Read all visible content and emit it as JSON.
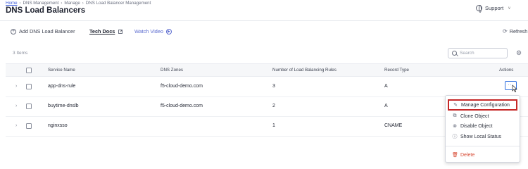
{
  "breadcrumb": {
    "home": "Home",
    "dns_management": "DNS Management",
    "manage": "Manage",
    "current": "DNS Load Balancer Management"
  },
  "page_title": "DNS Load Balancers",
  "header": {
    "support_label": "Support"
  },
  "toolbar": {
    "add_label": "Add DNS Load Balancer",
    "tech_docs_label": "Tech Docs",
    "watch_video_label": "Watch Video",
    "refresh_label": "Refresh"
  },
  "table": {
    "items_count": "3 Items",
    "search_placeholder": "Search",
    "columns": {
      "service_name": "Service Name",
      "dns_zones": "DNS Zones",
      "rules_count": "Number of Load Balancing Rules",
      "record_type": "Record Type",
      "actions": "Actions"
    },
    "rows": [
      {
        "service_name": "app-dns-rule",
        "dns_zones": "f5-cloud-demo.com",
        "rules_count": "3",
        "record_type": "A"
      },
      {
        "service_name": "buytime-dnslb",
        "dns_zones": "f5-cloud-demo.com",
        "rules_count": "2",
        "record_type": "A"
      },
      {
        "service_name": "nginxsso",
        "dns_zones": "",
        "rules_count": "1",
        "record_type": "CNAME"
      }
    ],
    "actions_button": "···"
  },
  "actions_menu": {
    "manage_configuration": "Manage Configuration",
    "clone_object": "Clone Object",
    "disable_object": "Disable Object",
    "show_local_status": "Show Local Status",
    "delete": "Delete"
  },
  "colors": {
    "accent": "#2f6fe0",
    "highlight": "#c62828",
    "danger": "#d6452e",
    "link": "#3b5bdb"
  },
  "icons": [
    "globe-icon",
    "chevron-down-icon",
    "add-icon",
    "external-link-icon",
    "play-icon",
    "refresh-icon",
    "search-icon",
    "settings-icon",
    "expand-icon",
    "edit-icon",
    "clone-icon",
    "disable-icon",
    "info-icon",
    "trash-icon"
  ]
}
